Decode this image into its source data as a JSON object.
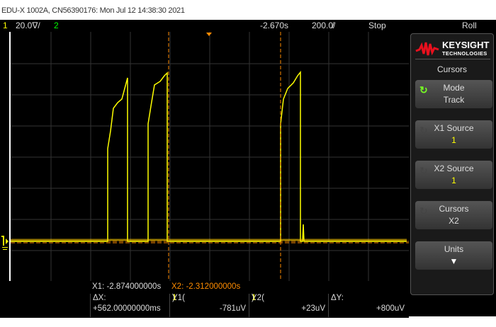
{
  "title": "EDU-X 1002A, CN56390176: Mon Jul 12 14:38:30 2021",
  "topbar": {
    "ch1": "1",
    "ch1_scale": "20.0∇/",
    "ch2": "2",
    "time_offset": "-2.670s",
    "time_scale": "200.0̸/",
    "run_state": "Stop",
    "mode": "Roll"
  },
  "brand": {
    "name": "KEYSIGHT",
    "sub": "TECHNOLOGIES"
  },
  "menu": {
    "title": "Cursors",
    "buttons": [
      {
        "label": "Mode",
        "value": "Track"
      },
      {
        "label": "X1 Source",
        "value": "1"
      },
      {
        "label": "X2 Source",
        "value": "1"
      },
      {
        "label": "Cursors",
        "value": "X2"
      },
      {
        "label": "Units",
        "value": ""
      }
    ]
  },
  "readout": {
    "x1": "X1: -2.874000000s",
    "x2": "X2: -2.312000000s",
    "dx_label": "ΔX:",
    "dx": "+562.00000000ms",
    "y1_label": "Y1(",
    "y1_ch": "1",
    "y1_end": "):",
    "y1": "-781uV",
    "y2_label": "Y2(",
    "y2_ch": "1",
    "y2_end": "):",
    "y2": "+23uV",
    "dy_label": "ΔY:",
    "dy": "+800uV"
  },
  "colors": {
    "ch1": "#ffff00",
    "cursor": "#ff8c00",
    "ch2": "#00ff00"
  }
}
